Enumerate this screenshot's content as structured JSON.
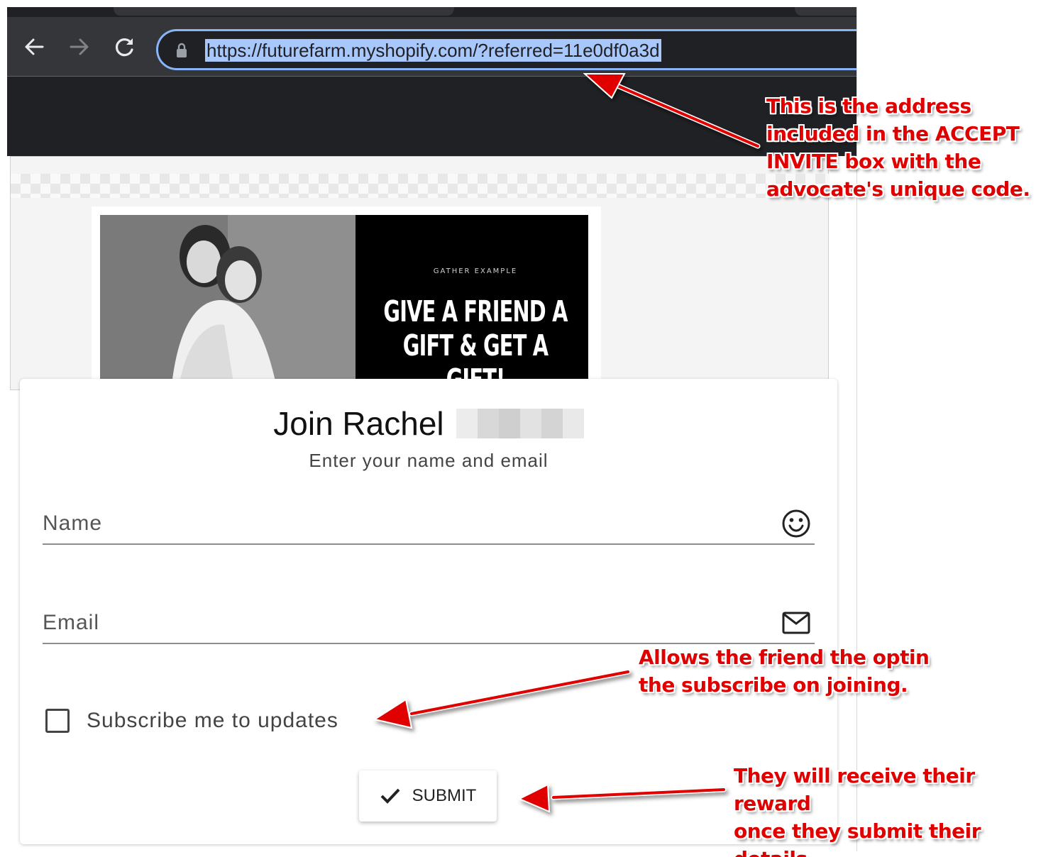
{
  "browser": {
    "url": "https://futurefarm.myshopify.com/?referred=11e0df0a3d"
  },
  "banner": {
    "small_text": "GATHER EXAMPLE",
    "headline": "GIVE A FRIEND A GIFT & GET A GIFT!"
  },
  "form": {
    "title": "Join Rachel",
    "subtitle": "Enter your name and email",
    "name_placeholder": "Name",
    "email_placeholder": "Email",
    "subscribe_label": "Subscribe me to updates",
    "submit_label": "SUBMIT"
  },
  "annotations": {
    "address_note": "This is the address\nincluded in the ACCEPT\nINVITE box with the\nadvocate's unique code.",
    "optin_note": "Allows the friend the optin\nthe subscribe on joining.",
    "reward_note": "They will receive their reward\nonce they submit their details."
  },
  "colors": {
    "annotation_red": "#e00000",
    "url_highlight": "#a8c7fa",
    "omnibox_focus": "#8ab4f8"
  },
  "icons": [
    "back-arrow-icon",
    "forward-arrow-icon",
    "reload-icon",
    "lock-icon",
    "smiley-icon",
    "envelope-icon",
    "checkmark-icon"
  ]
}
